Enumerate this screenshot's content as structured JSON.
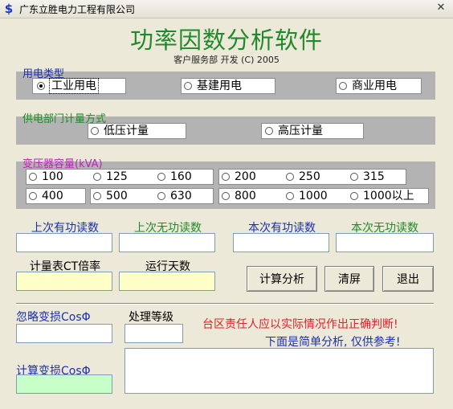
{
  "window": {
    "title": "广东立胜电力工程有限公司",
    "close_glyph": "✕",
    "app_icon_glyph": "$"
  },
  "header": {
    "app_title": "功率因数分析软件",
    "subtitle": "客户服务部 开发 (C) 2005"
  },
  "power_type": {
    "label": "用电类型",
    "options": [
      {
        "label": "工业用电",
        "selected": true
      },
      {
        "label": "基建用电",
        "selected": false
      },
      {
        "label": "商业用电",
        "selected": false
      }
    ]
  },
  "metering": {
    "label": "供电部门计量方式",
    "options": [
      {
        "label": "低压计量",
        "selected": false
      },
      {
        "label": "高压计量",
        "selected": false
      }
    ]
  },
  "transformer": {
    "label": "变压器容量(kVA)",
    "options": [
      "100",
      "125",
      "160",
      "200",
      "250",
      "315",
      "400",
      "500",
      "630",
      "800",
      "1000",
      "1000以上"
    ]
  },
  "readings": {
    "last_active": {
      "label": "上次有功读数",
      "value": ""
    },
    "last_reactive": {
      "label": "上次无功读数",
      "value": ""
    },
    "current_active": {
      "label": "本次有功读数",
      "value": ""
    },
    "current_reactive": {
      "label": "本次无功读数",
      "value": ""
    }
  },
  "ct_ratio": {
    "label": "计量表CT倍率",
    "value": ""
  },
  "run_days": {
    "label": "运行天数",
    "value": ""
  },
  "buttons": {
    "analyze": "计算分析",
    "clear": "清屏",
    "exit": "退出"
  },
  "ignore_cos": {
    "label": "忽略变损CosΦ",
    "value": ""
  },
  "level": {
    "label": "处理等级",
    "value": ""
  },
  "calc_cos": {
    "label": "计算变损CosΦ",
    "value": ""
  },
  "messages": {
    "warning": "台区责任人应以实际情况作出正确判断!",
    "note": "下面是简单分析, 仅供参考!"
  },
  "result": {
    "value": ""
  },
  "colors": {
    "title_green": "#1f8a2b",
    "label_blue": "#1a2fb0",
    "label_green": "#1f8a2b",
    "label_magenta": "#c020c0",
    "warning_red": "#e0202a",
    "yellow_field": "#ffffc8",
    "green_field": "#c8ffc8",
    "band_gray": "#b3b3b3"
  }
}
